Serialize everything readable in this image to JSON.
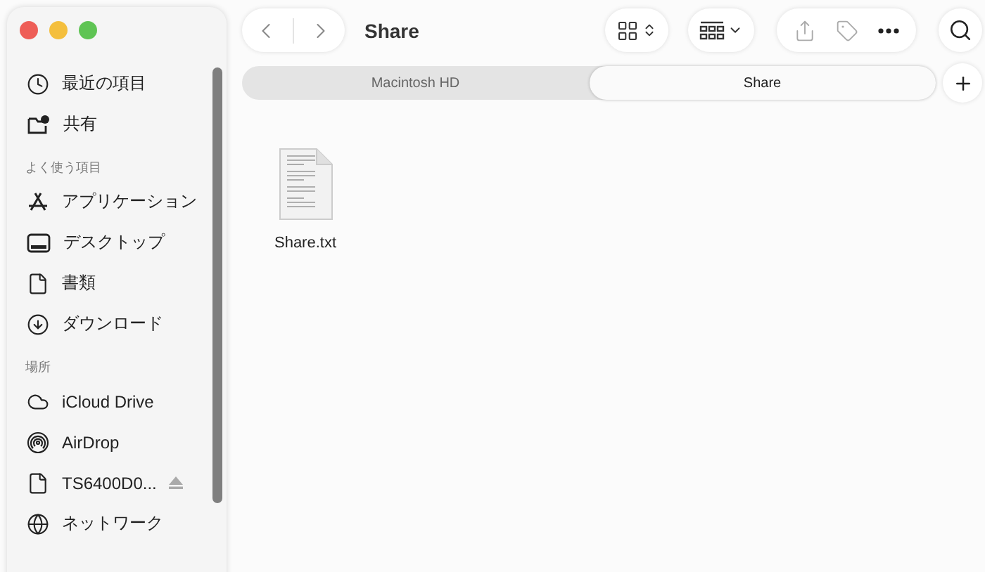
{
  "window": {
    "title": "Share"
  },
  "sidebar": {
    "items": [
      {
        "kind": "item",
        "label": "最近の項目"
      },
      {
        "kind": "item",
        "label": "共有"
      },
      {
        "kind": "header",
        "label": "よく使う項目"
      },
      {
        "kind": "item",
        "label": "アプリケーション"
      },
      {
        "kind": "item",
        "label": "デスクトップ"
      },
      {
        "kind": "item",
        "label": "書類"
      },
      {
        "kind": "item",
        "label": "ダウンロード"
      },
      {
        "kind": "header",
        "label": "場所"
      },
      {
        "kind": "item",
        "label": "iCloud Drive"
      },
      {
        "kind": "item",
        "label": "AirDrop"
      },
      {
        "kind": "item",
        "label": "TS6400D0...",
        "eject": true
      },
      {
        "kind": "item",
        "label": "ネットワーク"
      }
    ]
  },
  "tabs": [
    {
      "label": "Macintosh HD",
      "selected": false
    },
    {
      "label": "Share",
      "selected": true
    }
  ],
  "files": [
    {
      "name": "Share.txt"
    }
  ]
}
